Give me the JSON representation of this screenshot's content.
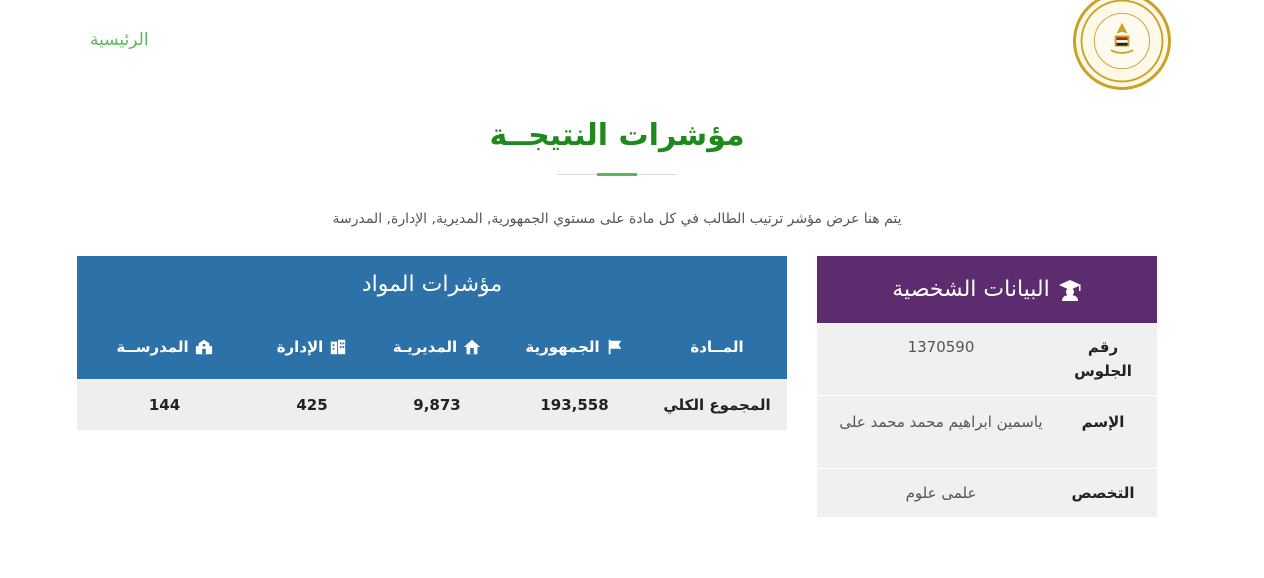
{
  "nav": {
    "home_label": "الرئيسية"
  },
  "logo": {
    "name": "ministry-of-education-logo",
    "text": "MINISTRY OF EDUCATION AND TECHNICAL EDUCATION"
  },
  "page": {
    "title": "مؤشرات النتيجــة",
    "description": "يتم هنا عرض مؤشر ترتيب الطالب في كل مادة على مستوي الجمهورية, المديرية, الإدارة, المدرسة"
  },
  "subjects": {
    "title": "مؤشرات المواد",
    "columns": {
      "subject": "المــادة",
      "republic": "الجمهورية",
      "directorate": "المديريـة",
      "administration": "الإدارة",
      "school": "المدرســة"
    },
    "rows": [
      {
        "subject": "المجموع الكلي",
        "republic": "193,558",
        "directorate": "9,873",
        "administration": "425",
        "school": "144"
      }
    ]
  },
  "personal": {
    "title": "البيانات الشخصية",
    "seat_label": "رقم الجلوس",
    "seat_value": "1370590",
    "name_label": "الإسم",
    "name_value": "ياسمين ابراهيم محمد محمد على",
    "specialization_label": "التخصص",
    "specialization_value": "علمى علوم"
  },
  "colors": {
    "title_green": "#1e8a1e",
    "link_green": "#5cb85c",
    "blue_header": "#2c72a8",
    "purple_header": "#5c2c6e",
    "gold_logo": "#c9a227"
  },
  "icons": [
    "flag-icon",
    "home-icon",
    "building-icon",
    "school-icon",
    "graduate-icon"
  ]
}
